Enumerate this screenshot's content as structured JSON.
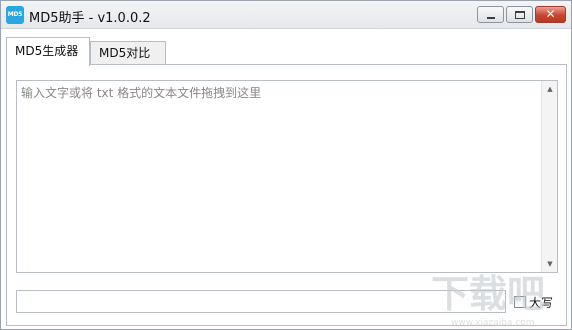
{
  "window": {
    "title": "MD5助手 - v1.0.0.2",
    "app_icon_text": "MD5",
    "close_glyph": "✕"
  },
  "tabs": [
    {
      "label": "MD5生成器",
      "active": true
    },
    {
      "label": "MD5对比",
      "active": false
    }
  ],
  "generator": {
    "input_placeholder": "输入文字或将 txt 格式的文本文件拖拽到这里",
    "input_value": "",
    "output_value": "",
    "uppercase_label": "大写",
    "uppercase_checked": false
  },
  "scrollbar": {
    "up_glyph": "▲",
    "down_glyph": "▼"
  },
  "watermark": {
    "text": "下载吧",
    "url": "www.xiazaiba.com"
  }
}
